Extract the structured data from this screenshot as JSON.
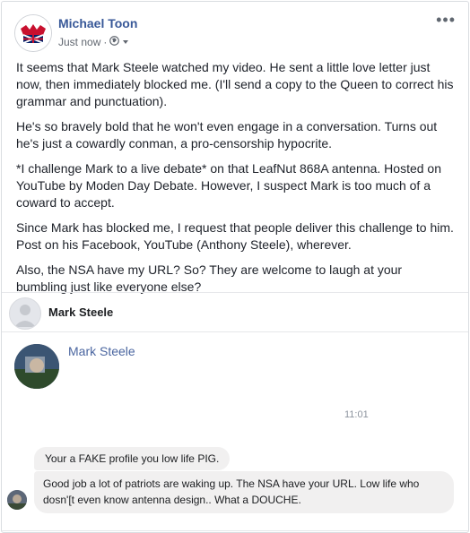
{
  "post": {
    "author": "Michael Toon",
    "timestamp": "Just now",
    "audience_icon": "globe-icon",
    "paragraphs": [
      "It seems that Mark Steele watched my video. He sent a little love letter just now, then immediately blocked me. (I'll send a copy to the Queen to correct his grammar and punctuation).",
      "He's so bravely bold that he won't even engage in a conversation. Turns out he's just a cowardly conman, a pro-censorship hypocrite.",
      "*I challenge Mark to a live debate* on that LeafNut 868A antenna. Hosted on YouTube by Moden Day Debate. However, I suspect Mark is too much of a coward to accept.",
      "Since Mark has blocked me, I request that people deliver this challenge to him. Post on his Facebook, YouTube (Anthony Steele), wherever.",
      "Also, the NSA have my URL? So? They are welcome to laugh at your bumbling just like everyone else?"
    ]
  },
  "screenshot": {
    "header_name": "Mark Steele",
    "contact_name": "Mark Steele",
    "time": "11:01",
    "messages": [
      "Your a FAKE profile you low life PIG.",
      "Good job a lot of patriots are waking up. The NSA have your URL.  Low life who dosn'[t even know antenna design.. What a DOUCHE."
    ]
  },
  "colors": {
    "link_blue": "#385898",
    "bubble_gray": "#f1f0f0",
    "meta_gray": "#616770"
  }
}
